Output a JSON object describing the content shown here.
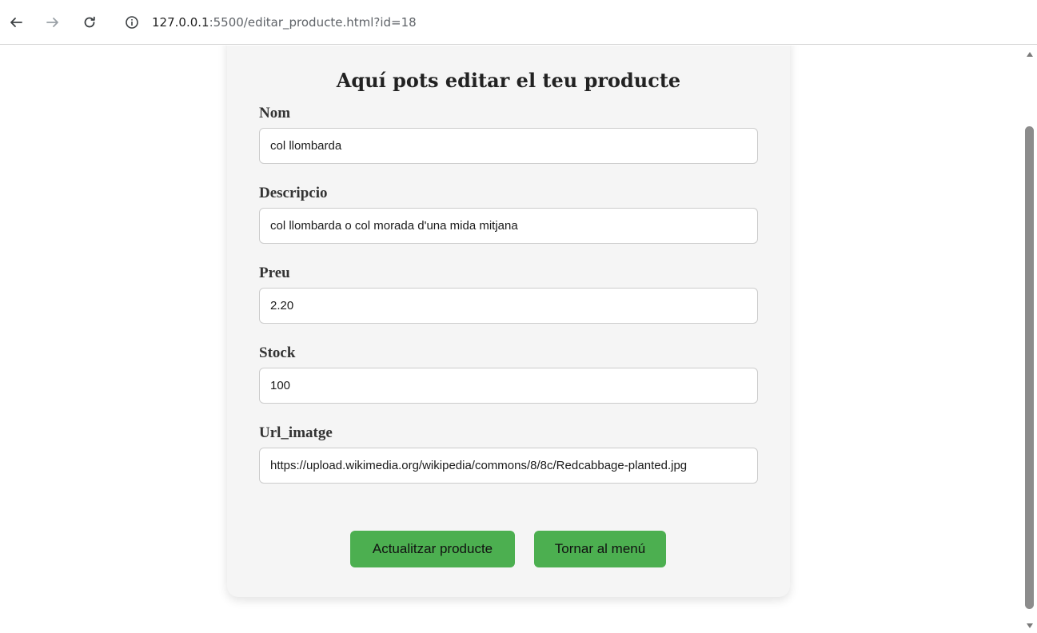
{
  "browser": {
    "url_host": "127.0.0.1",
    "url_rest": ":5500/editar_producte.html?id=18"
  },
  "form": {
    "title": "Aquí pots editar el teu producte",
    "fields": [
      {
        "label": "Nom",
        "value": "col llombarda"
      },
      {
        "label": "Descripcio",
        "value": "col llombarda o col morada d'una mida mitjana"
      },
      {
        "label": "Preu",
        "value": "2.20"
      },
      {
        "label": "Stock",
        "value": "100"
      },
      {
        "label": "Url_imatge",
        "value": "https://upload.wikimedia.org/wikipedia/commons/8/8c/Redcabbage-planted.jpg"
      }
    ],
    "update_button": "Actualitzar producte",
    "back_button": "Tornar al menú"
  },
  "colors": {
    "button": "#4caf50",
    "card": "#f5f5f5"
  }
}
